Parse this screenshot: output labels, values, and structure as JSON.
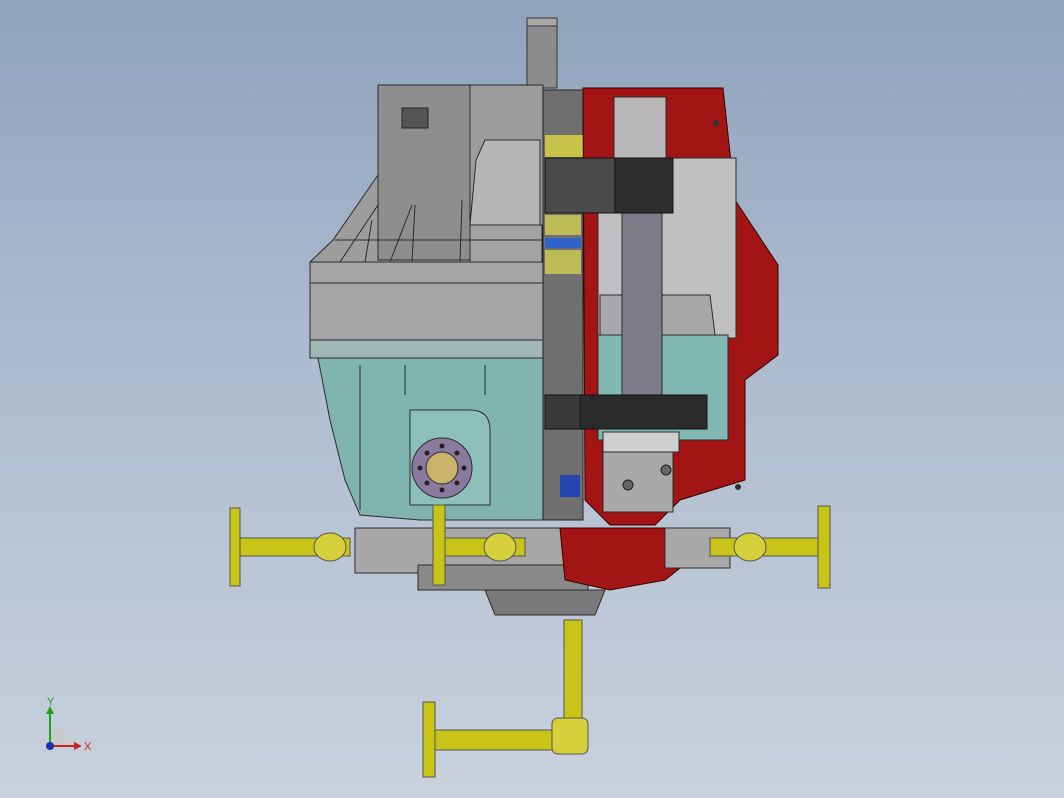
{
  "viewport": {
    "background_top": "#8fa3bd",
    "background_bottom": "#c9d1dc"
  },
  "model": {
    "section_color": "#a31515",
    "housing_gray": "#9a9a9a",
    "housing_teal": "#7fb3ad",
    "pipe_color": "#c9c418",
    "gear_color": "#3a3a3a"
  },
  "triad": {
    "y_label": "Y",
    "x_label": "X",
    "y_color": "#1aa11a",
    "x_color": "#cc2222",
    "z_color": "#1f2fb0"
  }
}
